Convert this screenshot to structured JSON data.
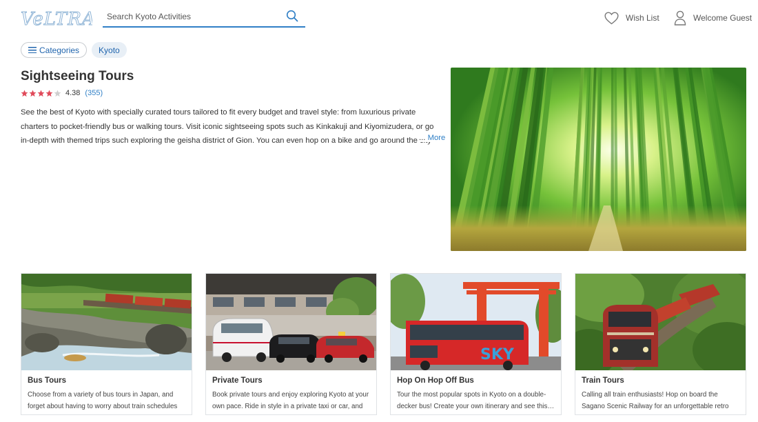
{
  "brand": {
    "logo_text": "VeLTRA",
    "brand_color": "#8fb4d6"
  },
  "search": {
    "placeholder": "Search Kyoto Activities"
  },
  "header": {
    "wishlist_label": "Wish List",
    "account_label": "Welcome Guest"
  },
  "breadcrumb": {
    "categories_label": "Categories",
    "city_label": "Kyoto"
  },
  "hero": {
    "title": "Sightseeing Tours",
    "rating": {
      "score": "4.38",
      "count": "(355)",
      "stars_filled": 4,
      "stars_total": 5,
      "star_color": "#e04a5a"
    },
    "description": "See the best of Kyoto with specially curated tours tailored to fit every budget and travel style: from luxurious private charters to pocket-friendly bus or walking tours. Visit iconic sightseeing spots such as Kinkakuji and Kiyomizudera, or go in-depth with themed trips such exploring the geisha district of Gion. You can even hop on a bike and go around the city or ride a rickshaw.",
    "more_dots": "...",
    "more_label": "More"
  },
  "cards": [
    {
      "title": "Bus Tours",
      "description": "Choose from a variety of bus tours in Japan, and forget about having to worry about train schedules or…"
    },
    {
      "title": "Private Tours",
      "description": "Book private tours and enjoy exploring Kyoto at your own pace. Ride in style in a private taxi or car, and g…"
    },
    {
      "title": "Hop On Hop Off Bus",
      "description": "Tour the most popular spots in Kyoto on a double-decker bus! Create your own itinerary and see this…"
    },
    {
      "title": "Train Tours",
      "description": "Calling all train enthusiasts! Hop on board the Sagano Scenic Railway for an unforgettable retro train ride. I…"
    }
  ],
  "colors": {
    "link": "#2f7fc6",
    "accent": "#1f64ad",
    "chip_bg": "#e8eff6"
  }
}
